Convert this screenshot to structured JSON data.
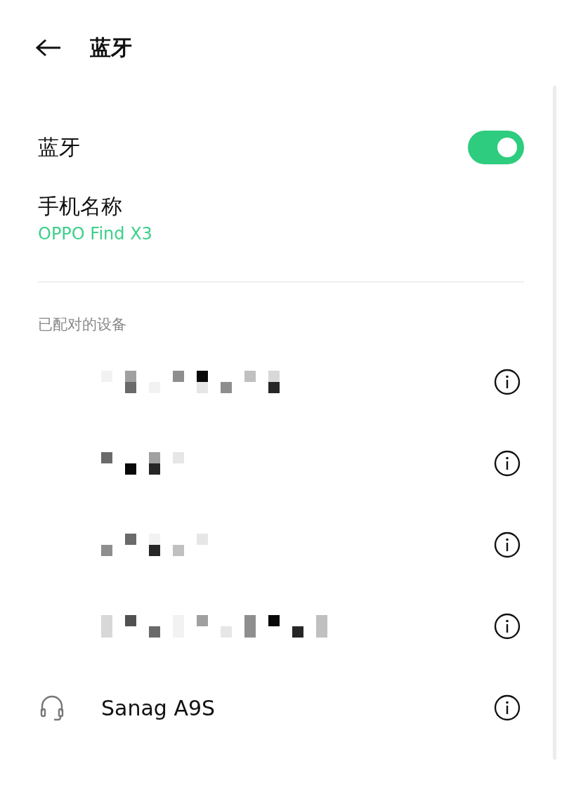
{
  "header": {
    "title": "蓝牙"
  },
  "bluetooth": {
    "label": "蓝牙",
    "on": true
  },
  "phone_name": {
    "label": "手机名称",
    "value": "OPPO Find X3"
  },
  "paired_section": {
    "title": "已配对的设备"
  },
  "devices": [
    {
      "kind": "redacted"
    },
    {
      "kind": "redacted"
    },
    {
      "kind": "redacted"
    },
    {
      "kind": "redacted"
    },
    {
      "kind": "headset",
      "name": "Sanag A9S"
    }
  ]
}
